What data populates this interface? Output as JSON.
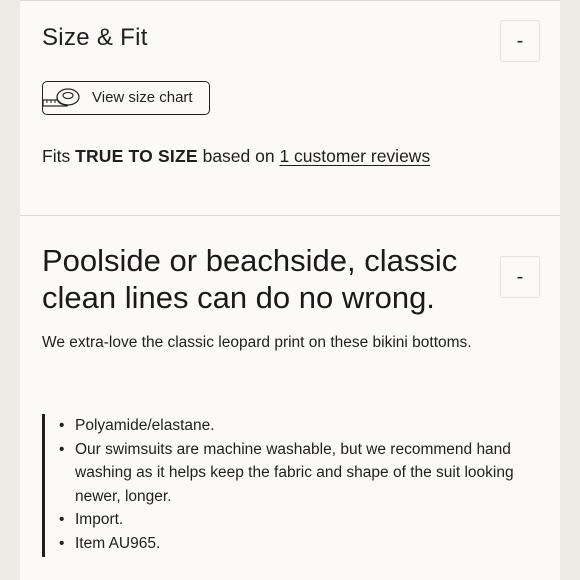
{
  "size_fit": {
    "title": "Size & Fit",
    "toggle_label": "-",
    "size_chart_button": "View size chart",
    "fits_prefix": "Fits ",
    "fits_value": "TRUE TO SIZE",
    "fits_middle": " based on ",
    "reviews_link": "1 customer reviews"
  },
  "details": {
    "headline": "Poolside or beachside, classic clean lines can do no wrong.",
    "toggle_label": "-",
    "description": "We extra-love the classic leopard print on these bikini bottoms.",
    "bullets": [
      "Polyamide/elastane.",
      "Our swimsuits are machine washable, but we recommend hand washing as it helps keep the fabric and shape of the suit looking newer, longer.",
      "Import.",
      "Item AU965."
    ]
  },
  "icons": {
    "size_chart": "tape-measure-icon"
  }
}
